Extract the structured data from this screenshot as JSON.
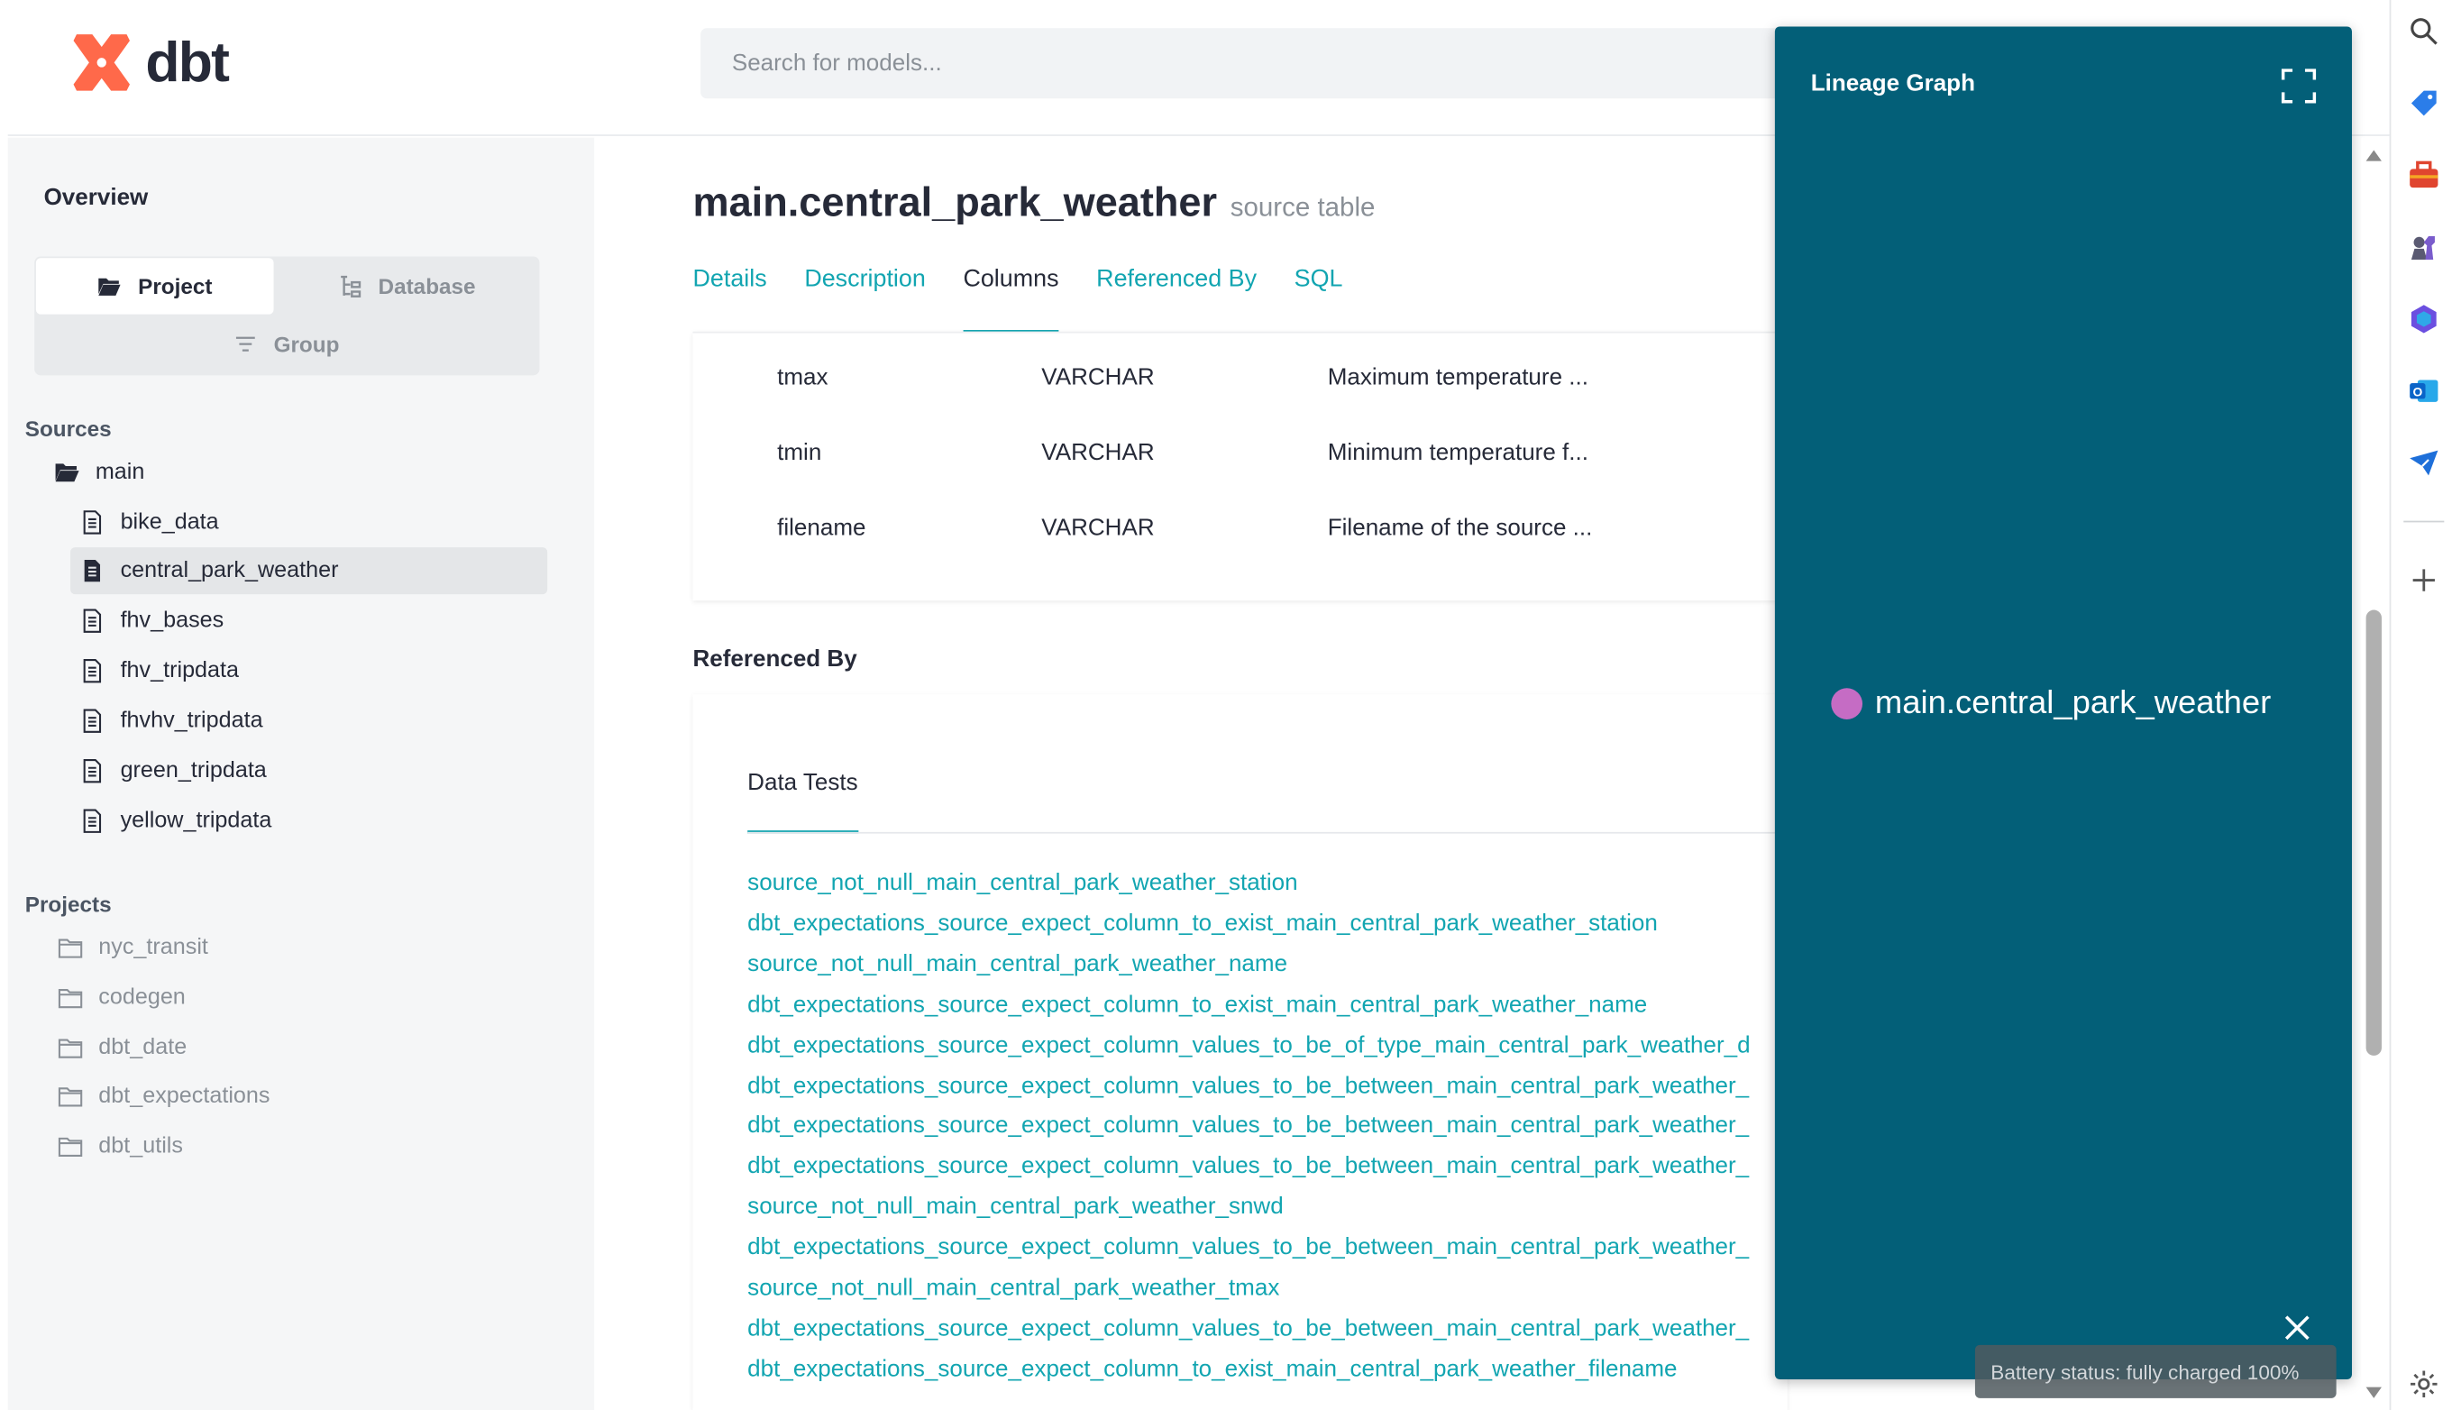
{
  "header": {
    "logo_text": "dbt",
    "search_placeholder": "Search for models..."
  },
  "sidebar": {
    "overview_label": "Overview",
    "switcher": {
      "project": "Project",
      "database": "Database",
      "group": "Group"
    },
    "sources_label": "Sources",
    "source_folder": "main",
    "source_items": [
      "bike_data",
      "central_park_weather",
      "fhv_bases",
      "fhv_tripdata",
      "fhvhv_tripdata",
      "green_tripdata",
      "yellow_tripdata"
    ],
    "active_item": "central_park_weather",
    "projects_label": "Projects",
    "projects": [
      "nyc_transit",
      "codegen",
      "dbt_date",
      "dbt_expectations",
      "dbt_utils"
    ]
  },
  "main": {
    "title": "main.central_park_weather",
    "subtitle": "source table",
    "tabs": [
      "Details",
      "Description",
      "Columns",
      "Referenced By",
      "SQL"
    ],
    "active_tab": "Columns",
    "columns": [
      {
        "name": "tmax",
        "type": "VARCHAR",
        "description": "Maximum temperature ..."
      },
      {
        "name": "tmin",
        "type": "VARCHAR",
        "description": "Minimum temperature f..."
      },
      {
        "name": "filename",
        "type": "VARCHAR",
        "description": "Filename of the source ..."
      }
    ],
    "referenced_by_label": "Referenced By",
    "data_tests_tab": "Data Tests",
    "tests": [
      "source_not_null_main_central_park_weather_station",
      "dbt_expectations_source_expect_column_to_exist_main_central_park_weather_station",
      "source_not_null_main_central_park_weather_name",
      "dbt_expectations_source_expect_column_to_exist_main_central_park_weather_name",
      "dbt_expectations_source_expect_column_values_to_be_of_type_main_central_park_weather_d",
      "dbt_expectations_source_expect_column_values_to_be_between_main_central_park_weather_",
      "dbt_expectations_source_expect_column_values_to_be_between_main_central_park_weather_",
      "dbt_expectations_source_expect_column_values_to_be_between_main_central_park_weather_",
      "source_not_null_main_central_park_weather_snwd",
      "dbt_expectations_source_expect_column_values_to_be_between_main_central_park_weather_",
      "source_not_null_main_central_park_weather_tmax",
      "dbt_expectations_source_expect_column_values_to_be_between_main_central_park_weather_",
      "dbt_expectations_source_expect_column_to_exist_main_central_park_weather_filename"
    ]
  },
  "lineage": {
    "title": "Lineage Graph",
    "node_label": "main.central_park_weather",
    "node_color": "#c56cc4",
    "panel_color": "#035f78"
  },
  "toast": {
    "text": "Battery status: fully charged 100%"
  },
  "colors": {
    "accent": "#12a5b1",
    "logo": "#ff694a"
  }
}
